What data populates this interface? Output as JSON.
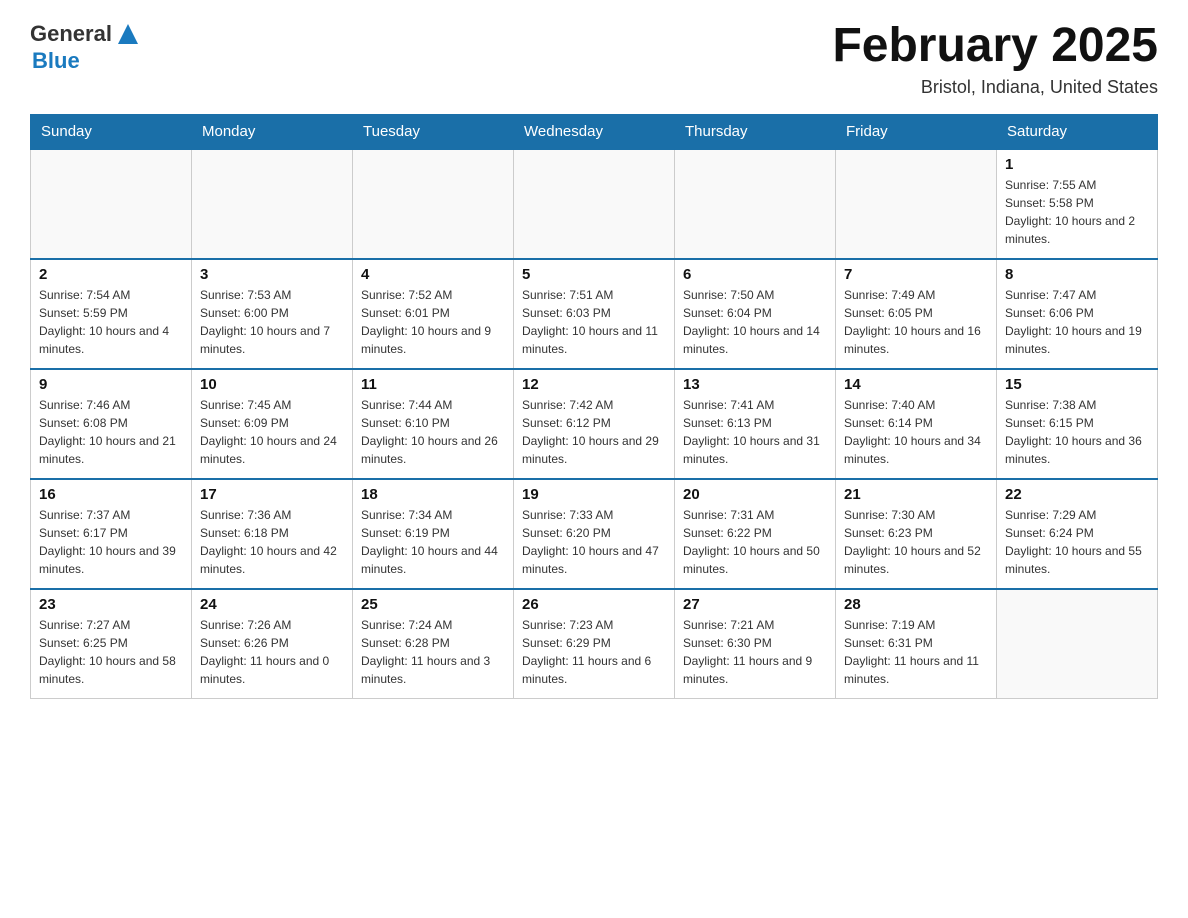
{
  "header": {
    "logo": {
      "general": "General",
      "blue": "Blue",
      "triangle_color": "#1a7abf"
    },
    "title": "February 2025",
    "location": "Bristol, Indiana, United States"
  },
  "weekdays": [
    "Sunday",
    "Monday",
    "Tuesday",
    "Wednesday",
    "Thursday",
    "Friday",
    "Saturday"
  ],
  "weeks": [
    [
      {
        "day": "",
        "sunrise": "",
        "sunset": "",
        "daylight": ""
      },
      {
        "day": "",
        "sunrise": "",
        "sunset": "",
        "daylight": ""
      },
      {
        "day": "",
        "sunrise": "",
        "sunset": "",
        "daylight": ""
      },
      {
        "day": "",
        "sunrise": "",
        "sunset": "",
        "daylight": ""
      },
      {
        "day": "",
        "sunrise": "",
        "sunset": "",
        "daylight": ""
      },
      {
        "day": "",
        "sunrise": "",
        "sunset": "",
        "daylight": ""
      },
      {
        "day": "1",
        "sunrise": "Sunrise: 7:55 AM",
        "sunset": "Sunset: 5:58 PM",
        "daylight": "Daylight: 10 hours and 2 minutes."
      }
    ],
    [
      {
        "day": "2",
        "sunrise": "Sunrise: 7:54 AM",
        "sunset": "Sunset: 5:59 PM",
        "daylight": "Daylight: 10 hours and 4 minutes."
      },
      {
        "day": "3",
        "sunrise": "Sunrise: 7:53 AM",
        "sunset": "Sunset: 6:00 PM",
        "daylight": "Daylight: 10 hours and 7 minutes."
      },
      {
        "day": "4",
        "sunrise": "Sunrise: 7:52 AM",
        "sunset": "Sunset: 6:01 PM",
        "daylight": "Daylight: 10 hours and 9 minutes."
      },
      {
        "day": "5",
        "sunrise": "Sunrise: 7:51 AM",
        "sunset": "Sunset: 6:03 PM",
        "daylight": "Daylight: 10 hours and 11 minutes."
      },
      {
        "day": "6",
        "sunrise": "Sunrise: 7:50 AM",
        "sunset": "Sunset: 6:04 PM",
        "daylight": "Daylight: 10 hours and 14 minutes."
      },
      {
        "day": "7",
        "sunrise": "Sunrise: 7:49 AM",
        "sunset": "Sunset: 6:05 PM",
        "daylight": "Daylight: 10 hours and 16 minutes."
      },
      {
        "day": "8",
        "sunrise": "Sunrise: 7:47 AM",
        "sunset": "Sunset: 6:06 PM",
        "daylight": "Daylight: 10 hours and 19 minutes."
      }
    ],
    [
      {
        "day": "9",
        "sunrise": "Sunrise: 7:46 AM",
        "sunset": "Sunset: 6:08 PM",
        "daylight": "Daylight: 10 hours and 21 minutes."
      },
      {
        "day": "10",
        "sunrise": "Sunrise: 7:45 AM",
        "sunset": "Sunset: 6:09 PM",
        "daylight": "Daylight: 10 hours and 24 minutes."
      },
      {
        "day": "11",
        "sunrise": "Sunrise: 7:44 AM",
        "sunset": "Sunset: 6:10 PM",
        "daylight": "Daylight: 10 hours and 26 minutes."
      },
      {
        "day": "12",
        "sunrise": "Sunrise: 7:42 AM",
        "sunset": "Sunset: 6:12 PM",
        "daylight": "Daylight: 10 hours and 29 minutes."
      },
      {
        "day": "13",
        "sunrise": "Sunrise: 7:41 AM",
        "sunset": "Sunset: 6:13 PM",
        "daylight": "Daylight: 10 hours and 31 minutes."
      },
      {
        "day": "14",
        "sunrise": "Sunrise: 7:40 AM",
        "sunset": "Sunset: 6:14 PM",
        "daylight": "Daylight: 10 hours and 34 minutes."
      },
      {
        "day": "15",
        "sunrise": "Sunrise: 7:38 AM",
        "sunset": "Sunset: 6:15 PM",
        "daylight": "Daylight: 10 hours and 36 minutes."
      }
    ],
    [
      {
        "day": "16",
        "sunrise": "Sunrise: 7:37 AM",
        "sunset": "Sunset: 6:17 PM",
        "daylight": "Daylight: 10 hours and 39 minutes."
      },
      {
        "day": "17",
        "sunrise": "Sunrise: 7:36 AM",
        "sunset": "Sunset: 6:18 PM",
        "daylight": "Daylight: 10 hours and 42 minutes."
      },
      {
        "day": "18",
        "sunrise": "Sunrise: 7:34 AM",
        "sunset": "Sunset: 6:19 PM",
        "daylight": "Daylight: 10 hours and 44 minutes."
      },
      {
        "day": "19",
        "sunrise": "Sunrise: 7:33 AM",
        "sunset": "Sunset: 6:20 PM",
        "daylight": "Daylight: 10 hours and 47 minutes."
      },
      {
        "day": "20",
        "sunrise": "Sunrise: 7:31 AM",
        "sunset": "Sunset: 6:22 PM",
        "daylight": "Daylight: 10 hours and 50 minutes."
      },
      {
        "day": "21",
        "sunrise": "Sunrise: 7:30 AM",
        "sunset": "Sunset: 6:23 PM",
        "daylight": "Daylight: 10 hours and 52 minutes."
      },
      {
        "day": "22",
        "sunrise": "Sunrise: 7:29 AM",
        "sunset": "Sunset: 6:24 PM",
        "daylight": "Daylight: 10 hours and 55 minutes."
      }
    ],
    [
      {
        "day": "23",
        "sunrise": "Sunrise: 7:27 AM",
        "sunset": "Sunset: 6:25 PM",
        "daylight": "Daylight: 10 hours and 58 minutes."
      },
      {
        "day": "24",
        "sunrise": "Sunrise: 7:26 AM",
        "sunset": "Sunset: 6:26 PM",
        "daylight": "Daylight: 11 hours and 0 minutes."
      },
      {
        "day": "25",
        "sunrise": "Sunrise: 7:24 AM",
        "sunset": "Sunset: 6:28 PM",
        "daylight": "Daylight: 11 hours and 3 minutes."
      },
      {
        "day": "26",
        "sunrise": "Sunrise: 7:23 AM",
        "sunset": "Sunset: 6:29 PM",
        "daylight": "Daylight: 11 hours and 6 minutes."
      },
      {
        "day": "27",
        "sunrise": "Sunrise: 7:21 AM",
        "sunset": "Sunset: 6:30 PM",
        "daylight": "Daylight: 11 hours and 9 minutes."
      },
      {
        "day": "28",
        "sunrise": "Sunrise: 7:19 AM",
        "sunset": "Sunset: 6:31 PM",
        "daylight": "Daylight: 11 hours and 11 minutes."
      },
      {
        "day": "",
        "sunrise": "",
        "sunset": "",
        "daylight": ""
      }
    ]
  ]
}
